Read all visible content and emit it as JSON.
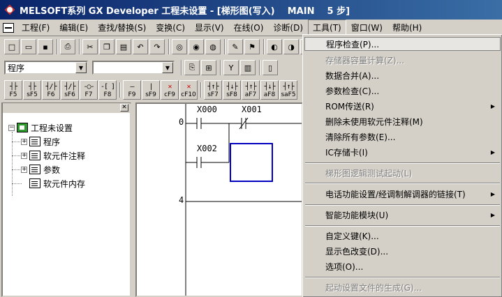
{
  "window": {
    "title": "MELSOFT系列 GX Developer 工程未设置 - [梯形图(写入)    MAIN    5 步]"
  },
  "menubar": {
    "items": [
      {
        "label": "工程(F)"
      },
      {
        "label": "编辑(E)"
      },
      {
        "label": "查找/替换(S)"
      },
      {
        "label": "变换(C)"
      },
      {
        "label": "显示(V)"
      },
      {
        "label": "在线(O)"
      },
      {
        "label": "诊断(D)"
      },
      {
        "label": "工具(T)"
      },
      {
        "label": "窗口(W)"
      },
      {
        "label": "帮助(H)"
      }
    ]
  },
  "toolbar2": {
    "combo1_value": "程序",
    "combo2_value": ""
  },
  "fkeys": [
    {
      "sym": "┤├",
      "label": "F5"
    },
    {
      "sym": "┤├",
      "label": "sF5"
    },
    {
      "sym": "┤/├",
      "label": "F6"
    },
    {
      "sym": "┤/├",
      "label": "sF6"
    },
    {
      "sym": "-○-",
      "label": "F7"
    },
    {
      "sym": "-[ ]",
      "label": "F8"
    },
    {
      "sym": "—",
      "label": "F9"
    },
    {
      "sym": "|",
      "label": "sF9"
    },
    {
      "sym": "✕",
      "label": "cF9"
    },
    {
      "sym": "✕",
      "label": "cF10"
    },
    {
      "sym": "┤↑├",
      "label": "sF7"
    },
    {
      "sym": "┤↓├",
      "label": "sF8"
    },
    {
      "sym": "┤↑├",
      "label": "aF7"
    },
    {
      "sym": "┤↓├",
      "label": "aF8"
    },
    {
      "sym": "┤↑├",
      "label": "saF5"
    }
  ],
  "tree": {
    "root": "工程未设置",
    "children": [
      {
        "label": "程序"
      },
      {
        "label": "软元件注释"
      },
      {
        "label": "参数"
      },
      {
        "label": "软元件内存"
      }
    ]
  },
  "ladder": {
    "steps": [
      "0",
      "4"
    ],
    "devices": [
      "X000",
      "X001",
      "X002"
    ]
  },
  "tools_menu": {
    "items": [
      {
        "label": "程序检查(P)...",
        "disabled": false,
        "submenu": false,
        "highlight": true
      },
      {
        "label": "存储器容量计算(Z)...",
        "disabled": true,
        "submenu": false
      },
      {
        "label": "数据合并(A)...",
        "disabled": false,
        "submenu": false
      },
      {
        "label": "参数检查(C)...",
        "disabled": false,
        "submenu": false
      },
      {
        "label": "ROM传送(R)",
        "disabled": false,
        "submenu": true
      },
      {
        "label": "删除未使用软元件注释(M)",
        "disabled": false,
        "submenu": false
      },
      {
        "label": "清除所有参数(E)...",
        "disabled": false,
        "submenu": false
      },
      {
        "label": "IC存储卡(I)",
        "disabled": false,
        "submenu": true
      },
      {
        "label": "梯形图逻辑测试起动(L)",
        "disabled": true,
        "submenu": false
      },
      {
        "label": "电话功能设置/经调制解调器的链接(T)",
        "disabled": false,
        "submenu": true
      },
      {
        "label": "智能功能模块(U)",
        "disabled": false,
        "submenu": true
      },
      {
        "label": "自定义键(K)...",
        "disabled": false,
        "submenu": false
      },
      {
        "label": "显示色改变(D)...",
        "disabled": false,
        "submenu": false
      },
      {
        "label": "选项(O)...",
        "disabled": false,
        "submenu": false
      },
      {
        "label": "起动设置文件的生成(G)...",
        "disabled": true,
        "submenu": false
      }
    ]
  }
}
